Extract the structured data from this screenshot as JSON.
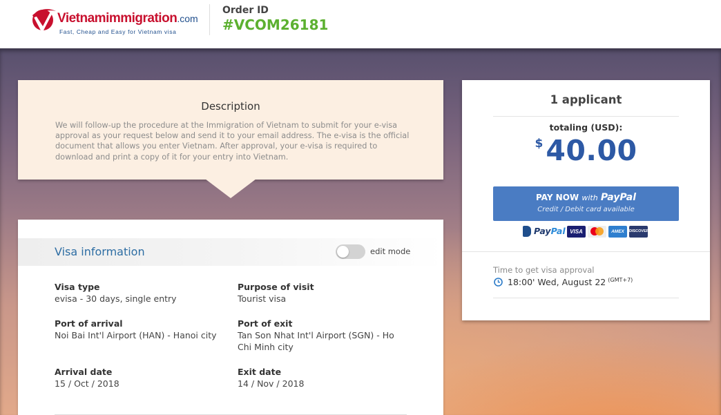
{
  "header": {
    "logo_name": "Vietnamimmigration",
    "logo_domain": ".com",
    "logo_tagline": "Fast, Cheap and Easy for Vietnam visa",
    "order_label": "Order ID",
    "order_id": "#VCOM26181"
  },
  "description": {
    "title": "Description",
    "text": "We will follow-up the procedure at the Immigration of Vietnam to submit for your e-visa approval as your request below and send it to your email address. The e-visa is the official document that allows you enter Vietnam. After approval, your e-visa is required to download and print a copy of it for your entry into Vietnam."
  },
  "visa_info": {
    "title": "Visa information",
    "edit_mode_label": "edit mode",
    "edit_mode_on": false,
    "fields": [
      {
        "label": "Visa type",
        "value": "evisa - 30 days, single entry"
      },
      {
        "label": "Purpose of visit",
        "value": "Tourist visa"
      },
      {
        "label": "Port of arrival",
        "value": "Noi Bai Int'l Airport (HAN) - Hanoi city"
      },
      {
        "label": "Port of exit",
        "value": "Tan Son Nhat Int'l Airport (SGN) - Ho Chi Minh city"
      },
      {
        "label": "Arrival date",
        "value": "15 / Oct / 2018"
      },
      {
        "label": "Exit date",
        "value": "14 / Nov / 2018"
      }
    ]
  },
  "payment": {
    "applicants": "1 applicant",
    "totaling_label": "totaling (USD):",
    "currency_symbol": "$",
    "amount": "40.00",
    "paypal_button": {
      "pay_now": "PAY NOW",
      "with": "with",
      "brand": "PayPal",
      "subtitle": "Credit / Debit card available"
    },
    "accepted": {
      "paypal_pay": "Pay",
      "paypal_pal": "Pal",
      "visa": "VISA",
      "mastercard_icon": "mastercard-icon",
      "amex": "AMEX",
      "discover": "DISCOVER"
    },
    "approval_label": "Time to get visa approval",
    "approval_time": "18:00' Wed, August 22",
    "approval_tz": "(GMT+7)"
  },
  "colors": {
    "brand_red": "#c8102e",
    "brand_blue": "#1f4e8c",
    "order_green": "#5cb030",
    "amount_blue": "#2d59a5",
    "paypal_button": "#4a7cc3",
    "description_bg": "#fcefe2",
    "visa_title_blue": "#2d6da3"
  }
}
